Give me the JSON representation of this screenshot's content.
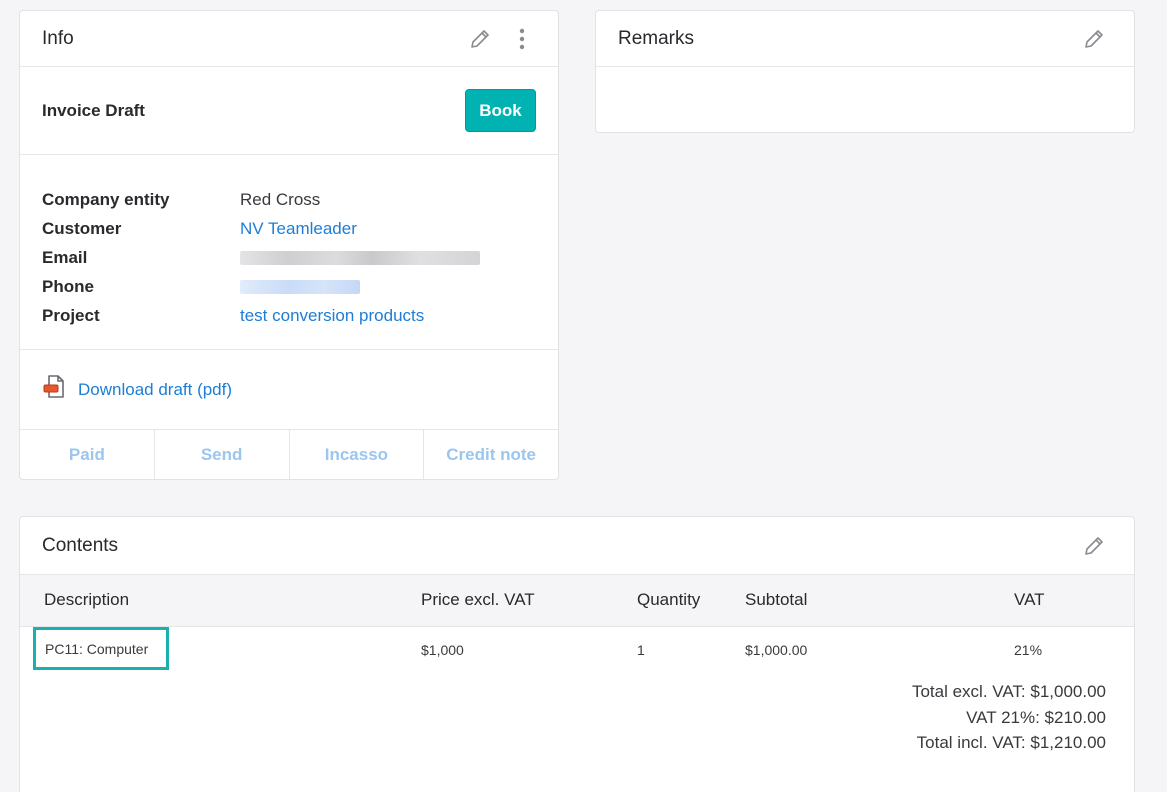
{
  "info": {
    "title": "Info",
    "status": "Invoice Draft",
    "book_label": "Book",
    "details": [
      {
        "key": "Company entity",
        "value": "Red Cross"
      },
      {
        "key": "Customer",
        "value": "NV Teamleader"
      },
      {
        "key": "Email",
        "value": ""
      },
      {
        "key": "Phone",
        "value": ""
      },
      {
        "key": "Project",
        "value": "test conversion products"
      }
    ],
    "download_label": "Download draft (pdf)",
    "actions": [
      "Paid",
      "Send",
      "Incasso",
      "Credit note"
    ]
  },
  "remarks": {
    "title": "Remarks"
  },
  "contents": {
    "title": "Contents",
    "columns": [
      "Description",
      "Price excl. VAT",
      "Quantity",
      "Subtotal",
      "VAT"
    ],
    "rows": [
      {
        "description": "PC11: Computer",
        "price": "$1,000",
        "quantity": "1",
        "subtotal": "$1,000.00",
        "vat": "21%"
      }
    ],
    "totals": {
      "excl": "Total excl. VAT: $1,000.00",
      "vat": "VAT 21%: $210.00",
      "incl": "Total incl. VAT: $1,210.00"
    }
  },
  "colors": {
    "accent": "#00b2b2",
    "link": "#1c7ed6",
    "disabled_action": "#9bc6ef"
  },
  "icons": [
    "pencil-icon",
    "more-vertical-icon",
    "pdf-file-icon"
  ]
}
